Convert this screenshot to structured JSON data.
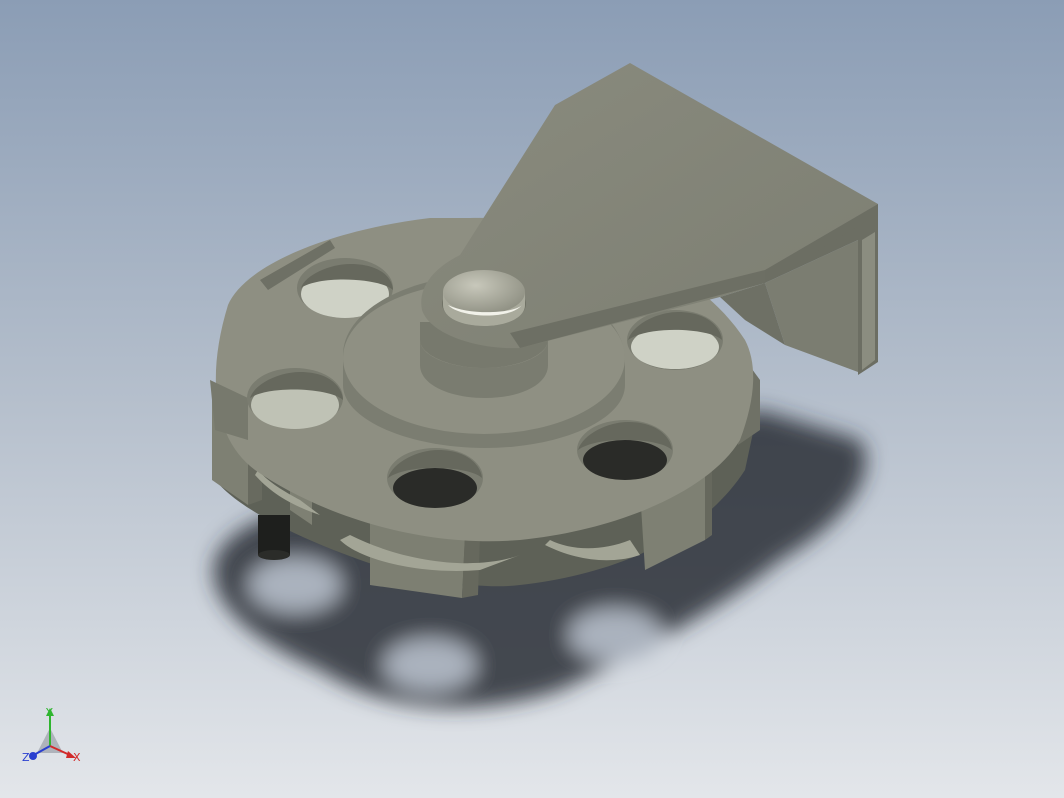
{
  "viewport": {
    "background_top": "#8b9db5",
    "background_bottom": "#e3e6ea",
    "part_color": "#8f9181",
    "part_top_color": "#8e8e81",
    "part_side_color": "#6f7266",
    "shadow_color": "#2a2d34"
  },
  "triad": {
    "x_label": "X",
    "y_label": "Y",
    "z_label": "Z",
    "x_color": "#d22a2a",
    "y_color": "#2fb52f",
    "z_color": "#2a3fd0"
  }
}
